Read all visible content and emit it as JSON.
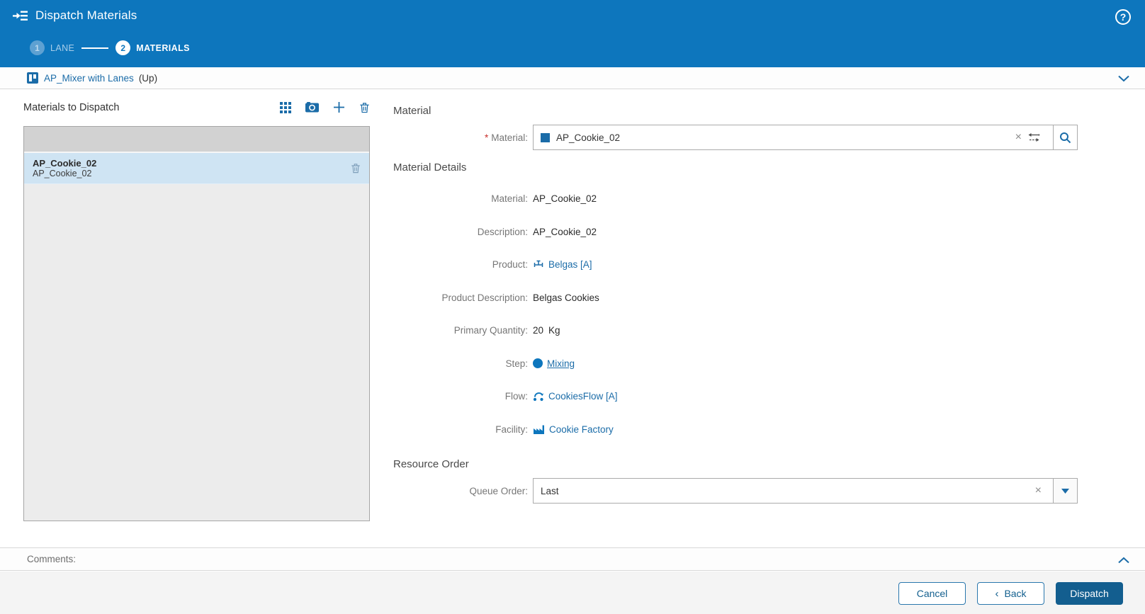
{
  "window": {
    "title": "Dispatch Materials"
  },
  "wizard": {
    "step1_number": "1",
    "step1_label": "LANE",
    "step2_number": "2",
    "step2_label": "MATERIALS"
  },
  "breadcrumb": {
    "link": "AP_Mixer with Lanes",
    "suffix": "(Up)"
  },
  "materials_panel": {
    "title": "Materials to Dispatch",
    "item": {
      "name": "AP_Cookie_02",
      "description": "AP_Cookie_02"
    }
  },
  "material_form": {
    "section_title": "Material",
    "required_marker": "*",
    "label": "Material:",
    "value": "AP_Cookie_02"
  },
  "details": {
    "section_title": "Material Details",
    "material_label": "Material:",
    "material_value": "AP_Cookie_02",
    "description_label": "Description:",
    "description_value": "AP_Cookie_02",
    "product_label": "Product:",
    "product_value": "Belgas [A]",
    "product_description_label": "Product Description:",
    "product_description_value": "Belgas Cookies",
    "primary_quantity_label": "Primary Quantity:",
    "primary_quantity_value": "20",
    "primary_quantity_unit": "Kg",
    "step_label": "Step:",
    "step_value": "Mixing",
    "flow_label": "Flow:",
    "flow_value": "CookiesFlow [A]",
    "facility_label": "Facility:",
    "facility_value": "Cookie Factory"
  },
  "resource_order": {
    "section_title": "Resource Order",
    "queue_order_label": "Queue Order:",
    "queue_order_value": "Last"
  },
  "comments": {
    "label": "Comments:"
  },
  "footer": {
    "cancel": "Cancel",
    "back": "Back",
    "dispatch": "Dispatch"
  },
  "icons": {
    "help": "?",
    "clear": "×",
    "back_chevron": "‹"
  },
  "colors": {
    "header_blue": "#0d76bd",
    "link_blue": "#1b6ca8",
    "primary_button": "#135e8f",
    "selected_row": "#cfe4f3"
  }
}
